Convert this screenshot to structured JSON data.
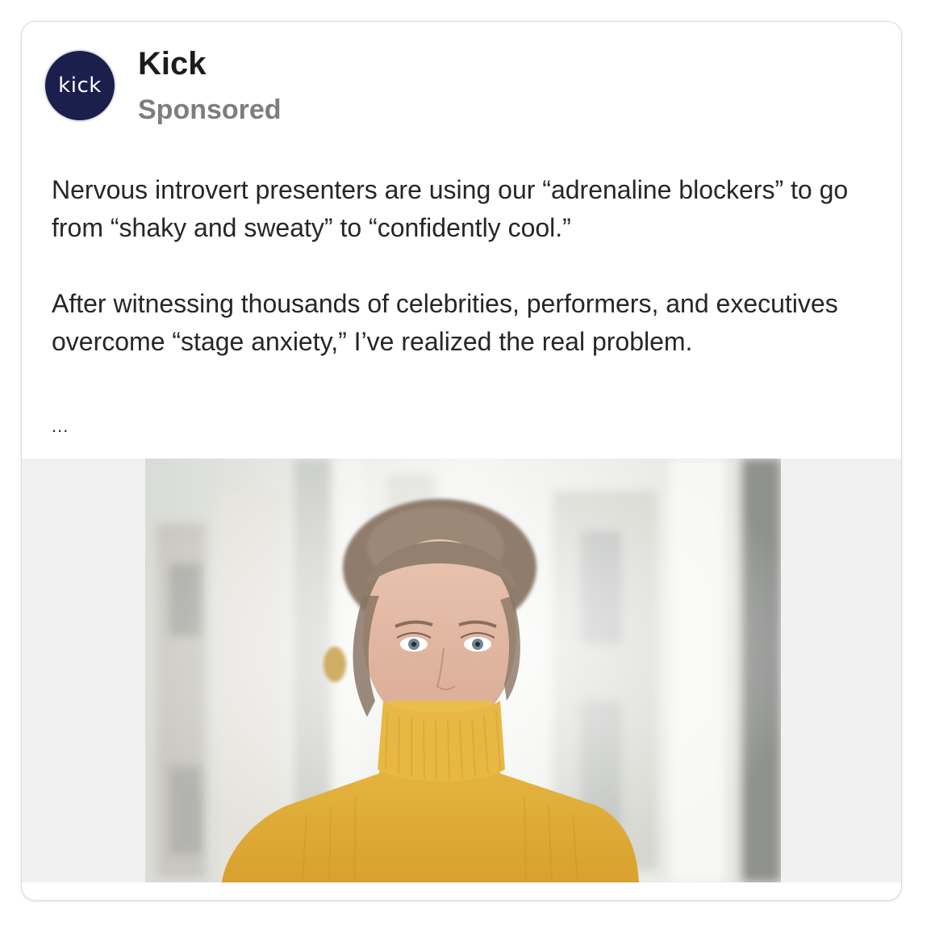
{
  "post": {
    "brand_name": "Kick",
    "brand_logo_text": "kick",
    "sponsored_label": "Sponsored",
    "paragraph_1": "Nervous introvert presenters are using our “adrenaline blockers” to go from “shaky and sweaty” to “confidently cool.”",
    "paragraph_2": "After witnessing thousands of celebrities, performers, and executives overcome “stage anxiety,” I’ve realized the real problem.",
    "more_indicator": "...",
    "image": {
      "subject": "woman in yellow turtleneck by a window",
      "icon": "photo"
    }
  },
  "colors": {
    "logo_background": "#1b1f4b",
    "sweater": "#e7b43a",
    "media_background": "#f1f1f1",
    "secondary_text": "#7d7d7d"
  }
}
